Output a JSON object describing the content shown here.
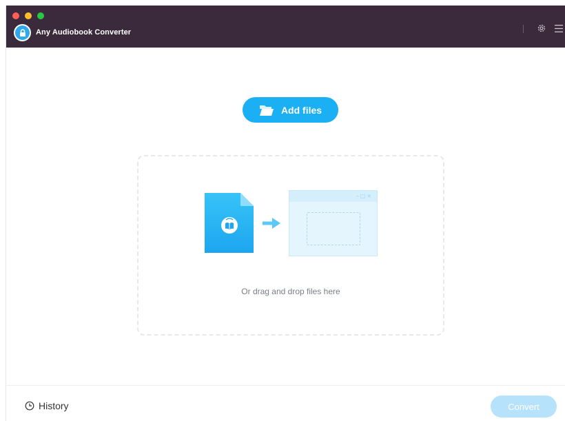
{
  "window": {
    "app_title": "Any Audiobook Converter"
  },
  "titlebar": {
    "icons": [
      "settings-gear-icon",
      "menu-icon"
    ]
  },
  "main": {
    "add_files_label": "Add files",
    "drop_hint": "Or drag and drop files here"
  },
  "footer": {
    "history_label": "History",
    "convert_label": "Convert",
    "convert_enabled": false
  },
  "colors": {
    "titlebar": "#3a2a3c",
    "accent": "#1ab0f3",
    "convert_disabled": "#b6e2fb",
    "drop_zone_border": "#e6e8ea"
  }
}
